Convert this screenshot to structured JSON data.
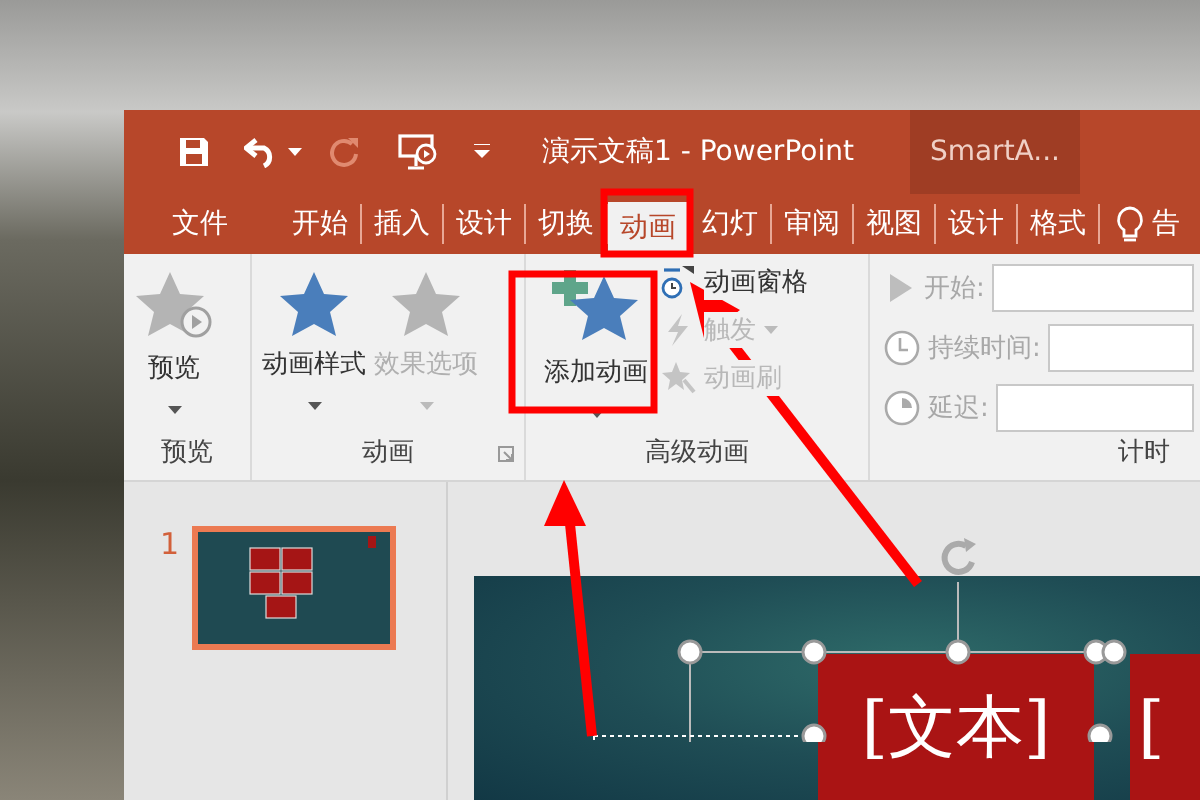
{
  "title_bar": {
    "title": "演示文稿1 - PowerPoint",
    "context_tab": "SmartA..."
  },
  "tabs": [
    {
      "label": "文件",
      "selected": false
    },
    {
      "label": "开始",
      "selected": false
    },
    {
      "label": "插入",
      "selected": false
    },
    {
      "label": "设计",
      "selected": false
    },
    {
      "label": "切换",
      "selected": false
    },
    {
      "label": "动画",
      "selected": true
    },
    {
      "label": "幻灯",
      "selected": false
    },
    {
      "label": "审阅",
      "selected": false
    },
    {
      "label": "视图",
      "selected": false
    },
    {
      "label": "设计",
      "selected": false
    },
    {
      "label": "格式",
      "selected": false
    }
  ],
  "tell_me": {
    "label": "告"
  },
  "ribbon": {
    "preview_group": {
      "label": "预览",
      "button": {
        "label": "预览",
        "dropdown": true,
        "disabled": false
      }
    },
    "animation_group": {
      "label": "动画",
      "buttons": [
        {
          "label": "动画样式",
          "dropdown": true,
          "disabled": false
        },
        {
          "label": "效果选项",
          "dropdown": true,
          "disabled": true
        }
      ]
    },
    "advanced_group": {
      "label": "高级动画",
      "add_button": {
        "label": "添加动画",
        "dropdown": true,
        "disabled": false
      },
      "small_buttons": [
        {
          "label": "动画窗格",
          "dropdown": false,
          "disabled": false
        },
        {
          "label": "触发",
          "dropdown": true,
          "disabled": true
        },
        {
          "label": "动画刷",
          "dropdown": false,
          "disabled": true
        }
      ]
    },
    "timing_group": {
      "label": "计时",
      "fields": [
        {
          "label": "开始:",
          "disabled": true
        },
        {
          "label": "持续时间:",
          "disabled": true
        },
        {
          "label": "延迟:",
          "disabled": true
        }
      ]
    }
  },
  "slides": [
    {
      "number": "1",
      "selected": true
    }
  ],
  "slide": {
    "text_boxes": [
      {
        "text": "[文本]"
      },
      {
        "text": "["
      }
    ]
  }
}
